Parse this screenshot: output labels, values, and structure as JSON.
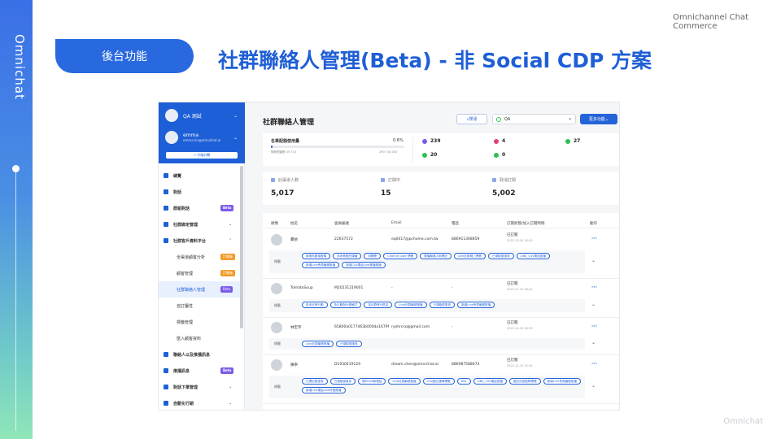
{
  "slide": {
    "brand_vertical": "Omnichat",
    "top_right_line1": "Omnichannel Chat",
    "top_right_line2": "Commerce",
    "footer_brand": "Omnichat",
    "section_pill": "後台功能",
    "title": "社群聯絡人管理(Beta) - 非 Social CDP 方案"
  },
  "app": {
    "sidebar": {
      "account1": "QA 測試",
      "account2_name": "emma",
      "account2_email": "emma.lin@omnichat.ai",
      "upgrade_label": "升級計劃",
      "items": [
        {
          "label": "總覽",
          "type": "main"
        },
        {
          "label": "對話",
          "type": "main"
        },
        {
          "label": "群組對話",
          "type": "main",
          "badge": "Beta"
        },
        {
          "label": "社群綁定管理",
          "type": "main",
          "chevron": "⌄"
        },
        {
          "label": "社群客戶資料平台",
          "type": "main",
          "chevron": "⌃"
        },
        {
          "label": "全渠道顧客分析",
          "type": "sub",
          "badge": "訂閱後"
        },
        {
          "label": "顧客管理",
          "type": "sub",
          "badge": "訂閱後"
        },
        {
          "label": "社群聯絡人管理",
          "type": "sub",
          "badge": "Beta",
          "active": true
        },
        {
          "label": "自訂屬性",
          "type": "sub"
        },
        {
          "label": "標籤管理",
          "type": "sub"
        },
        {
          "label": "匯入顧客資料",
          "type": "sub"
        },
        {
          "label": "聯絡人以及推播訊息",
          "type": "main"
        },
        {
          "label": "推播訊息",
          "type": "main",
          "badge": "Beta"
        },
        {
          "label": "對話下單管理",
          "type": "main",
          "chevron": "⌄"
        },
        {
          "label": "自動化行銷",
          "type": "main",
          "chevron": "⌄"
        }
      ]
    },
    "header": {
      "page_title": "社群聯絡人管理",
      "search_label": "搜尋",
      "channel_select": "QA",
      "more_label": "更多功能"
    },
    "quota": {
      "label": "名單配額使用量",
      "percent": "0.6%",
      "percent_value": 0.6,
      "sub_left": "剩餘配額數 49,710",
      "sub_right": "290 / 50,000",
      "channels": [
        {
          "name": "messenger",
          "count": "239",
          "color": "#7b5be8"
        },
        {
          "name": "instagram",
          "count": "4",
          "color": "#e2407a"
        },
        {
          "name": "line",
          "count": "27",
          "color": "#2fbf4f"
        },
        {
          "name": "webchat",
          "count": "20",
          "color": "#2fbf4f"
        },
        {
          "name": "whatsapp",
          "count": "0",
          "color": "#2fbf4f"
        }
      ]
    },
    "stats": [
      {
        "label": "此渠道人數",
        "value": "5,017"
      },
      {
        "label": "訂閱中",
        "value": "15"
      },
      {
        "label": "取消訂閱",
        "value": "5,002"
      }
    ],
    "table": {
      "headers": [
        "頭像",
        "姓名",
        "會員編號",
        "Email",
        "電話",
        "訂閱狀態/加入訂閱時間",
        "動作"
      ],
      "tag_label": "標籤",
      "rows": [
        {
          "name": "費依",
          "member_id": "22637572",
          "email": "eq0417@pchome.com.tw",
          "phone": "886911308859",
          "status": "已訂閱",
          "date": "2023-12-20 16:50",
          "tags": [
            "鄭德赤要領發傳",
            "赤赤佈程的傳播",
            "玩聰聰",
            "Channel user 標籤",
            "廣播聯絡人助標記",
            "Line社群線上標籤",
            "已領取優惠券",
            "LINE_CSV電話推播",
            "新增Line會員編號推播",
            "新增CSV電話Line推播推播"
          ]
        },
        {
          "name": "TomatoSoup",
          "member_id": "M20231219001",
          "email": "-",
          "phone": "-",
          "status": "已訂閱",
          "date": "2023-12-19 18:02",
          "tags": [
            "從未註冊行動",
            "永久贈與分優格式",
            "採社群會分區店",
            "Line社群編號推播",
            "已領取優惠券",
            "新增Line會員編號推播"
          ]
        },
        {
          "name": "林宏宇",
          "member_id": "65800a0177d63b000da1679f",
          "email": "ryohrcss@gmail.com",
          "phone": "-",
          "status": "已訂閱",
          "date": "2023-12-19 16:59",
          "tags": [
            "Line社群編號推播",
            "已領取優惠券"
          ]
        },
        {
          "name": "陳寧",
          "member_id": "D1930419129",
          "email": "dream.chen@omnichat.ai",
          "phone": "886987588673",
          "status": "已訂閱",
          "date": "2023-12-19 15:34",
          "tags": [
            "已標記優惠券",
            "已領取優惠券",
            "刪Email和電話",
            "Line社群編號推播",
            "Line圖文選單標籤",
            "test",
            "LINE_CSV電話推播",
            "圖文訊息點擊標籤",
            "新增Line會員編號推播",
            "新增CSV電話Line好發推播"
          ]
        }
      ]
    }
  }
}
